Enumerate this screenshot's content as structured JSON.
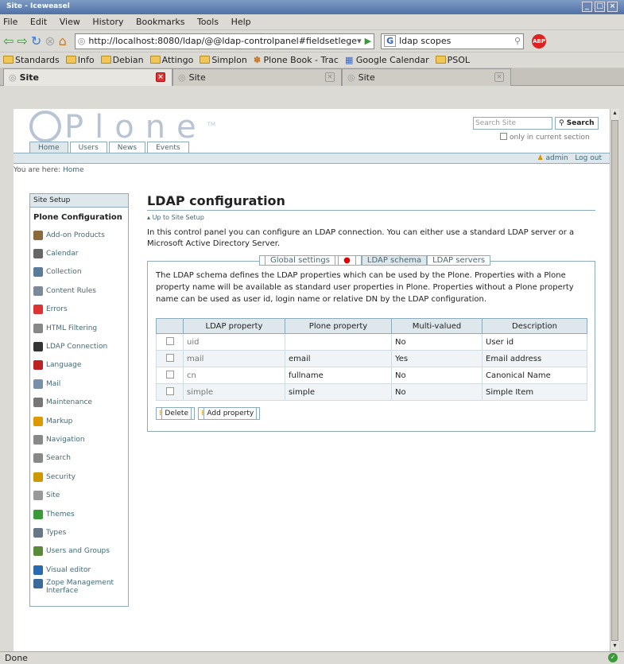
{
  "window": {
    "title": "Site - Iceweasel"
  },
  "menu": [
    "File",
    "Edit",
    "View",
    "History",
    "Bookmarks",
    "Tools",
    "Help"
  ],
  "navbar": {
    "url": "http://localhost:8080/ldap/@@ldap-controlpanel#fieldsetlege",
    "search_engine": "G",
    "search_value": "ldap scopes"
  },
  "bookmarks": [
    "Standards",
    "Info",
    "Debian",
    "Attingo",
    "Simplon",
    "Plone Book - Trac",
    "Google Calendar",
    "PSOL"
  ],
  "tabs": [
    {
      "label": "Site"
    },
    {
      "label": "Site"
    },
    {
      "label": "Site"
    }
  ],
  "plone": {
    "logo": "Plone",
    "logo_tm": "TM",
    "search_placeholder": "Search Site",
    "search_button": "Search",
    "only_current": "only in current section",
    "global_tabs": [
      "Home",
      "Users",
      "News",
      "Events"
    ],
    "user": "admin",
    "logout": "Log out",
    "breadcrumb_label": "You are here:",
    "breadcrumb_home": "Home"
  },
  "sidebar": {
    "header": "Site Setup",
    "current": "Plone Configuration",
    "items": [
      {
        "label": "Add-on Products",
        "icon": "package-icon",
        "color": "#8a6a3a"
      },
      {
        "label": "Calendar",
        "icon": "calendar-icon",
        "color": "#666"
      },
      {
        "label": "Collection",
        "icon": "collection-icon",
        "color": "#5a7a9a"
      },
      {
        "label": "Content Rules",
        "icon": "rules-icon",
        "color": "#7a8a9a"
      },
      {
        "label": "Errors",
        "icon": "error-icon",
        "color": "#d33"
      },
      {
        "label": "HTML Filtering",
        "icon": "filter-icon",
        "color": "#888"
      },
      {
        "label": "LDAP Connection",
        "icon": "ldap-icon",
        "color": "#333"
      },
      {
        "label": "Language",
        "icon": "language-icon",
        "color": "#b22"
      },
      {
        "label": "Mail",
        "icon": "mail-icon",
        "color": "#7a8fa8"
      },
      {
        "label": "Maintenance",
        "icon": "wrench-icon",
        "color": "#777"
      },
      {
        "label": "Markup",
        "icon": "pencil-icon",
        "color": "#d90"
      },
      {
        "label": "Navigation",
        "icon": "navigation-icon",
        "color": "#888"
      },
      {
        "label": "Search",
        "icon": "search-icon",
        "color": "#888"
      },
      {
        "label": "Security",
        "icon": "lock-icon",
        "color": "#c90"
      },
      {
        "label": "Site",
        "icon": "site-icon",
        "color": "#999"
      },
      {
        "label": "Themes",
        "icon": "themes-icon",
        "color": "#3a9a3a"
      },
      {
        "label": "Types",
        "icon": "types-icon",
        "color": "#678"
      },
      {
        "label": "Users and Groups",
        "icon": "users-icon",
        "color": "#5a8a3a"
      },
      {
        "label": "Visual editor",
        "icon": "visual-editor-icon",
        "color": "#2a6ab0"
      },
      {
        "label": "Zope Management Interface",
        "icon": "zope-icon",
        "color": "#3a6a9a"
      }
    ]
  },
  "main": {
    "title": "LDAP configuration",
    "up_link": "Up to Site Setup",
    "intro": "In this control panel you can configure an LDAP connection. You can either use a standard LDAP server or a Microsoft Active Directory Server.",
    "fieldset_tabs": [
      "Global settings",
      "LDAP schema",
      "LDAP servers"
    ],
    "desc": "The LDAP schema defines the LDAP properties which can be used by the Plone. Properties with a Plone property name will be available as standard user properties in Plone. Properties without a Plone property name can be used as user id, login name or relative DN by the LDAP configuration.",
    "columns": [
      "LDAP property",
      "Plone property",
      "Multi-valued",
      "Description"
    ],
    "rows": [
      [
        "uid",
        "",
        "No",
        "User id"
      ],
      [
        "mail",
        "email",
        "Yes",
        "Email address"
      ],
      [
        "cn",
        "fullname",
        "No",
        "Canonical Name"
      ],
      [
        "simple",
        "simple",
        "No",
        "Simple Item"
      ]
    ],
    "delete_button": "Delete",
    "add_button": "Add property"
  },
  "status": "Done"
}
